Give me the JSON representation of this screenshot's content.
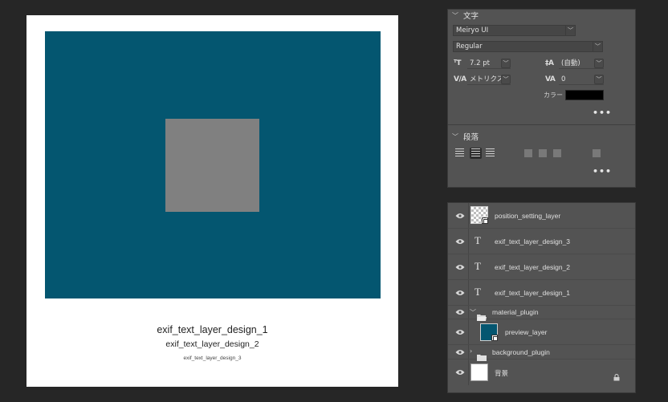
{
  "canvas": {
    "photo_color": "#045670",
    "square_color": "#808080",
    "captions": [
      "exif_text_layer_design_1",
      "exif_text_layer_design_2",
      "exif_text_layer_design_3"
    ]
  },
  "character_panel": {
    "title": "文字",
    "font_family": "Meiryo UI",
    "font_style": "Regular",
    "font_size": "7.2 pt",
    "leading": "(自動)",
    "kerning": "メトリクス",
    "tracking": "0",
    "color_label": "カラー",
    "text_color": "#000000",
    "more_label": "•••"
  },
  "paragraph_panel": {
    "title": "段落",
    "more_label": "•••"
  },
  "layers": [
    {
      "name": "position_setting_layer",
      "kind": "smart-object",
      "icon": "checker-thumbnail"
    },
    {
      "name": "exif_text_layer_design_3",
      "kind": "text",
      "icon": "T"
    },
    {
      "name": "exif_text_layer_design_2",
      "kind": "text",
      "icon": "T"
    },
    {
      "name": "exif_text_layer_design_1",
      "kind": "text",
      "icon": "T"
    },
    {
      "name": "material_plugin",
      "kind": "group-expanded",
      "icon": "folder-open-icon"
    },
    {
      "name": "preview_layer",
      "kind": "smart-object",
      "icon": "teal-thumbnail"
    },
    {
      "name": "background_plugin",
      "kind": "group-collapsed",
      "icon": "folder-icon"
    },
    {
      "name": "背景",
      "kind": "background",
      "icon": "white-thumbnail",
      "locked": true
    }
  ],
  "accent_colors": {
    "panel_bg": "#535353",
    "app_bg": "#262626"
  }
}
